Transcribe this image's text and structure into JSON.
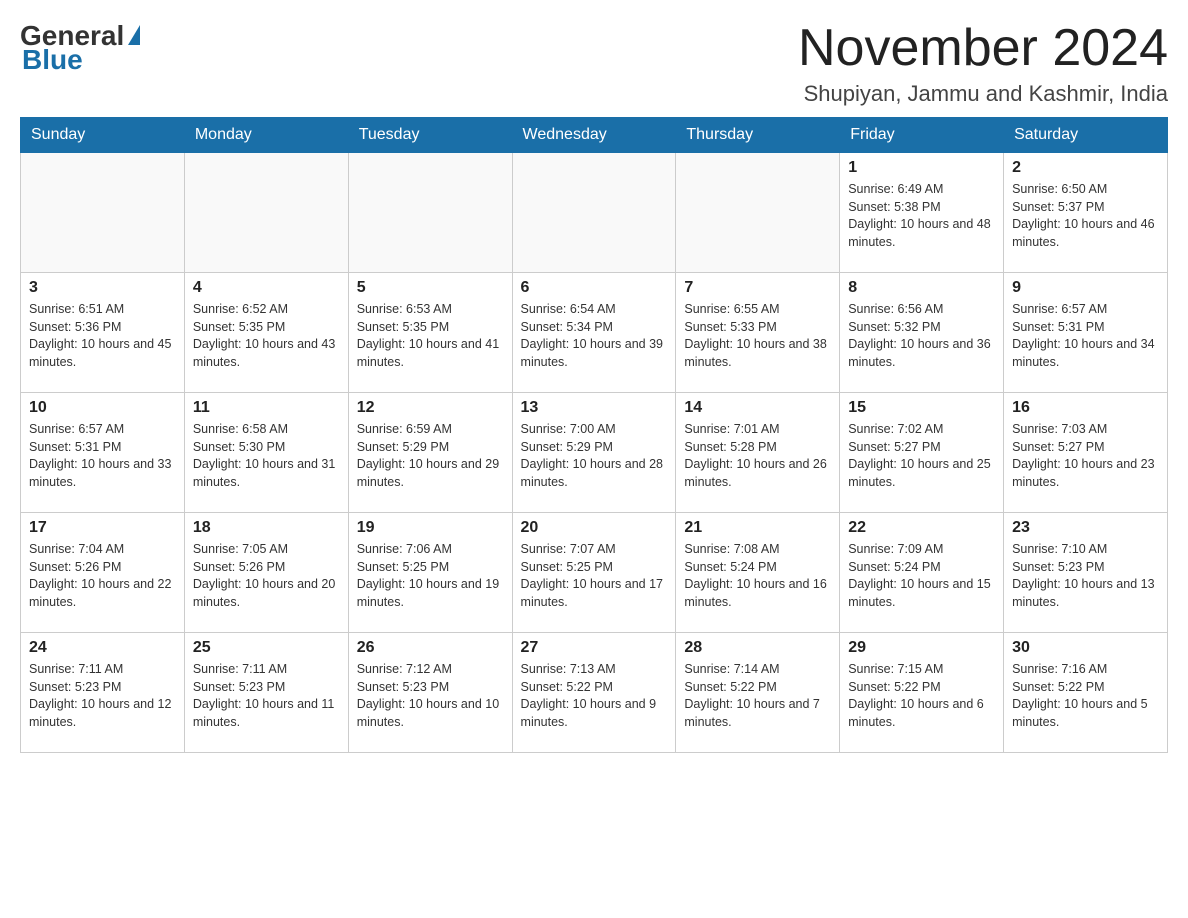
{
  "logo": {
    "general": "General",
    "blue": "Blue"
  },
  "header": {
    "month": "November 2024",
    "location": "Shupiyan, Jammu and Kashmir, India"
  },
  "days_of_week": [
    "Sunday",
    "Monday",
    "Tuesday",
    "Wednesday",
    "Thursday",
    "Friday",
    "Saturday"
  ],
  "weeks": [
    [
      {
        "day": "",
        "sunrise": "",
        "sunset": "",
        "daylight": ""
      },
      {
        "day": "",
        "sunrise": "",
        "sunset": "",
        "daylight": ""
      },
      {
        "day": "",
        "sunrise": "",
        "sunset": "",
        "daylight": ""
      },
      {
        "day": "",
        "sunrise": "",
        "sunset": "",
        "daylight": ""
      },
      {
        "day": "",
        "sunrise": "",
        "sunset": "",
        "daylight": ""
      },
      {
        "day": "1",
        "sunrise": "Sunrise: 6:49 AM",
        "sunset": "Sunset: 5:38 PM",
        "daylight": "Daylight: 10 hours and 48 minutes."
      },
      {
        "day": "2",
        "sunrise": "Sunrise: 6:50 AM",
        "sunset": "Sunset: 5:37 PM",
        "daylight": "Daylight: 10 hours and 46 minutes."
      }
    ],
    [
      {
        "day": "3",
        "sunrise": "Sunrise: 6:51 AM",
        "sunset": "Sunset: 5:36 PM",
        "daylight": "Daylight: 10 hours and 45 minutes."
      },
      {
        "day": "4",
        "sunrise": "Sunrise: 6:52 AM",
        "sunset": "Sunset: 5:35 PM",
        "daylight": "Daylight: 10 hours and 43 minutes."
      },
      {
        "day": "5",
        "sunrise": "Sunrise: 6:53 AM",
        "sunset": "Sunset: 5:35 PM",
        "daylight": "Daylight: 10 hours and 41 minutes."
      },
      {
        "day": "6",
        "sunrise": "Sunrise: 6:54 AM",
        "sunset": "Sunset: 5:34 PM",
        "daylight": "Daylight: 10 hours and 39 minutes."
      },
      {
        "day": "7",
        "sunrise": "Sunrise: 6:55 AM",
        "sunset": "Sunset: 5:33 PM",
        "daylight": "Daylight: 10 hours and 38 minutes."
      },
      {
        "day": "8",
        "sunrise": "Sunrise: 6:56 AM",
        "sunset": "Sunset: 5:32 PM",
        "daylight": "Daylight: 10 hours and 36 minutes."
      },
      {
        "day": "9",
        "sunrise": "Sunrise: 6:57 AM",
        "sunset": "Sunset: 5:31 PM",
        "daylight": "Daylight: 10 hours and 34 minutes."
      }
    ],
    [
      {
        "day": "10",
        "sunrise": "Sunrise: 6:57 AM",
        "sunset": "Sunset: 5:31 PM",
        "daylight": "Daylight: 10 hours and 33 minutes."
      },
      {
        "day": "11",
        "sunrise": "Sunrise: 6:58 AM",
        "sunset": "Sunset: 5:30 PM",
        "daylight": "Daylight: 10 hours and 31 minutes."
      },
      {
        "day": "12",
        "sunrise": "Sunrise: 6:59 AM",
        "sunset": "Sunset: 5:29 PM",
        "daylight": "Daylight: 10 hours and 29 minutes."
      },
      {
        "day": "13",
        "sunrise": "Sunrise: 7:00 AM",
        "sunset": "Sunset: 5:29 PM",
        "daylight": "Daylight: 10 hours and 28 minutes."
      },
      {
        "day": "14",
        "sunrise": "Sunrise: 7:01 AM",
        "sunset": "Sunset: 5:28 PM",
        "daylight": "Daylight: 10 hours and 26 minutes."
      },
      {
        "day": "15",
        "sunrise": "Sunrise: 7:02 AM",
        "sunset": "Sunset: 5:27 PM",
        "daylight": "Daylight: 10 hours and 25 minutes."
      },
      {
        "day": "16",
        "sunrise": "Sunrise: 7:03 AM",
        "sunset": "Sunset: 5:27 PM",
        "daylight": "Daylight: 10 hours and 23 minutes."
      }
    ],
    [
      {
        "day": "17",
        "sunrise": "Sunrise: 7:04 AM",
        "sunset": "Sunset: 5:26 PM",
        "daylight": "Daylight: 10 hours and 22 minutes."
      },
      {
        "day": "18",
        "sunrise": "Sunrise: 7:05 AM",
        "sunset": "Sunset: 5:26 PM",
        "daylight": "Daylight: 10 hours and 20 minutes."
      },
      {
        "day": "19",
        "sunrise": "Sunrise: 7:06 AM",
        "sunset": "Sunset: 5:25 PM",
        "daylight": "Daylight: 10 hours and 19 minutes."
      },
      {
        "day": "20",
        "sunrise": "Sunrise: 7:07 AM",
        "sunset": "Sunset: 5:25 PM",
        "daylight": "Daylight: 10 hours and 17 minutes."
      },
      {
        "day": "21",
        "sunrise": "Sunrise: 7:08 AM",
        "sunset": "Sunset: 5:24 PM",
        "daylight": "Daylight: 10 hours and 16 minutes."
      },
      {
        "day": "22",
        "sunrise": "Sunrise: 7:09 AM",
        "sunset": "Sunset: 5:24 PM",
        "daylight": "Daylight: 10 hours and 15 minutes."
      },
      {
        "day": "23",
        "sunrise": "Sunrise: 7:10 AM",
        "sunset": "Sunset: 5:23 PM",
        "daylight": "Daylight: 10 hours and 13 minutes."
      }
    ],
    [
      {
        "day": "24",
        "sunrise": "Sunrise: 7:11 AM",
        "sunset": "Sunset: 5:23 PM",
        "daylight": "Daylight: 10 hours and 12 minutes."
      },
      {
        "day": "25",
        "sunrise": "Sunrise: 7:11 AM",
        "sunset": "Sunset: 5:23 PM",
        "daylight": "Daylight: 10 hours and 11 minutes."
      },
      {
        "day": "26",
        "sunrise": "Sunrise: 7:12 AM",
        "sunset": "Sunset: 5:23 PM",
        "daylight": "Daylight: 10 hours and 10 minutes."
      },
      {
        "day": "27",
        "sunrise": "Sunrise: 7:13 AM",
        "sunset": "Sunset: 5:22 PM",
        "daylight": "Daylight: 10 hours and 9 minutes."
      },
      {
        "day": "28",
        "sunrise": "Sunrise: 7:14 AM",
        "sunset": "Sunset: 5:22 PM",
        "daylight": "Daylight: 10 hours and 7 minutes."
      },
      {
        "day": "29",
        "sunrise": "Sunrise: 7:15 AM",
        "sunset": "Sunset: 5:22 PM",
        "daylight": "Daylight: 10 hours and 6 minutes."
      },
      {
        "day": "30",
        "sunrise": "Sunrise: 7:16 AM",
        "sunset": "Sunset: 5:22 PM",
        "daylight": "Daylight: 10 hours and 5 minutes."
      }
    ]
  ]
}
